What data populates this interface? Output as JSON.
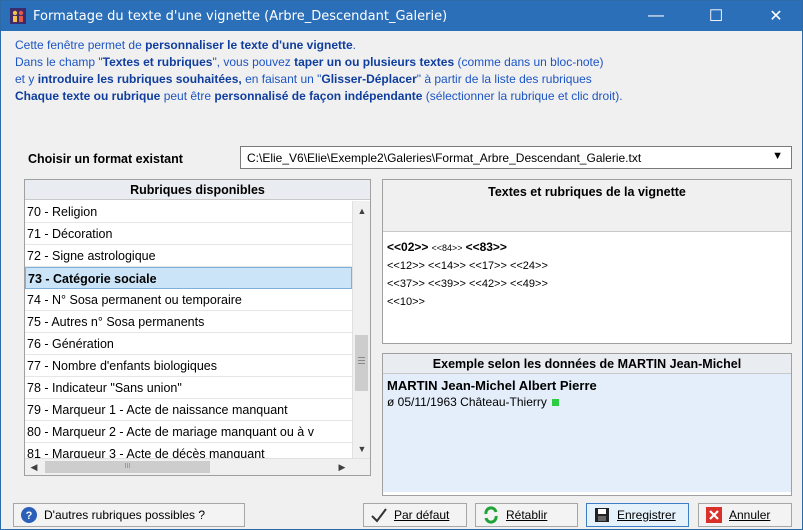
{
  "window": {
    "title": "Formatage du texte d'une vignette (Arbre_Descendant_Galerie)",
    "minimize_label": "—",
    "maximize_label": "☐",
    "close_label": "✕"
  },
  "intro": {
    "line1_pre": "Cette fenêtre permet de ",
    "line1_b": "personnaliser le texte d'une vignette",
    "line1_post": ".",
    "line2_a": "Dans le champ \"",
    "line2_b": "Textes et rubriques",
    "line2_c": "\", vous pouvez ",
    "line2_d": "taper un ou plusieurs textes",
    "line2_e": " (comme dans un bloc-note)",
    "line3_a": "et y ",
    "line3_b": "introduire les rubriques souhaitées,",
    "line3_c": " en faisant un \"",
    "line3_d": "Glisser-Déplacer",
    "line3_e": "\" à partir de la liste des rubriques",
    "line4_a": "Chaque texte ou rubrique",
    "line4_b": " peut être ",
    "line4_c": "personnalisé de façon indépendante",
    "line4_d": " (sélectionner la rubrique et clic droit)."
  },
  "format": {
    "label": "Choisir un format existant",
    "value": "C:\\Elie_V6\\Elie\\Exemple2\\Galeries\\Format_Arbre_Descendant_Galerie.txt"
  },
  "rubriques": {
    "header": "Rubriques disponibles",
    "items": [
      "70 - Religion",
      "71 - Décoration",
      "72 - Signe astrologique",
      "73 - Catégorie sociale",
      "74 - N° Sosa  permanent ou temporaire",
      "75 - Autres n° Sosa permanents",
      "76 - Génération",
      "77 - Nombre d'enfants biologiques",
      "78 - Indicateur \"Sans union\"",
      "79 - Marqueur 1 - Acte de naissance manquant",
      "80 - Marqueur 2 - Acte de mariage manquant ou à v",
      "81 - Marqueur 3 - Acte de décès manquant"
    ],
    "hscroll_mark": "III"
  },
  "textes": {
    "header": "Textes et rubriques de la vignette",
    "line1_a": "<<02>>",
    "line1_b": "<<84>>",
    "line1_c": "<<83>>",
    "line2": "<<12>> <<14>> <<17>> <<24>>",
    "line3": "<<37>> <<39>> <<42>> <<49>>",
    "line4": "<<10>>"
  },
  "example": {
    "header": "Exemple selon les données de MARTIN Jean-Michel",
    "name": "MARTIN Jean-Michel Albert Pierre",
    "birth": "ø 05/11/1963 Château-Thierry",
    "marker_color": "#2ecc40"
  },
  "buttons": {
    "help": "D'autres rubriques possibles ?",
    "default": "Par défaut",
    "restore": "Rétablir",
    "save": "Enregistrer",
    "cancel": "Annuler"
  },
  "colors": {
    "title_bar": "#2b6fb8",
    "intro_text": "#1c55c4",
    "selection": "#cce4f7",
    "example_bg": "#e3eefa"
  }
}
